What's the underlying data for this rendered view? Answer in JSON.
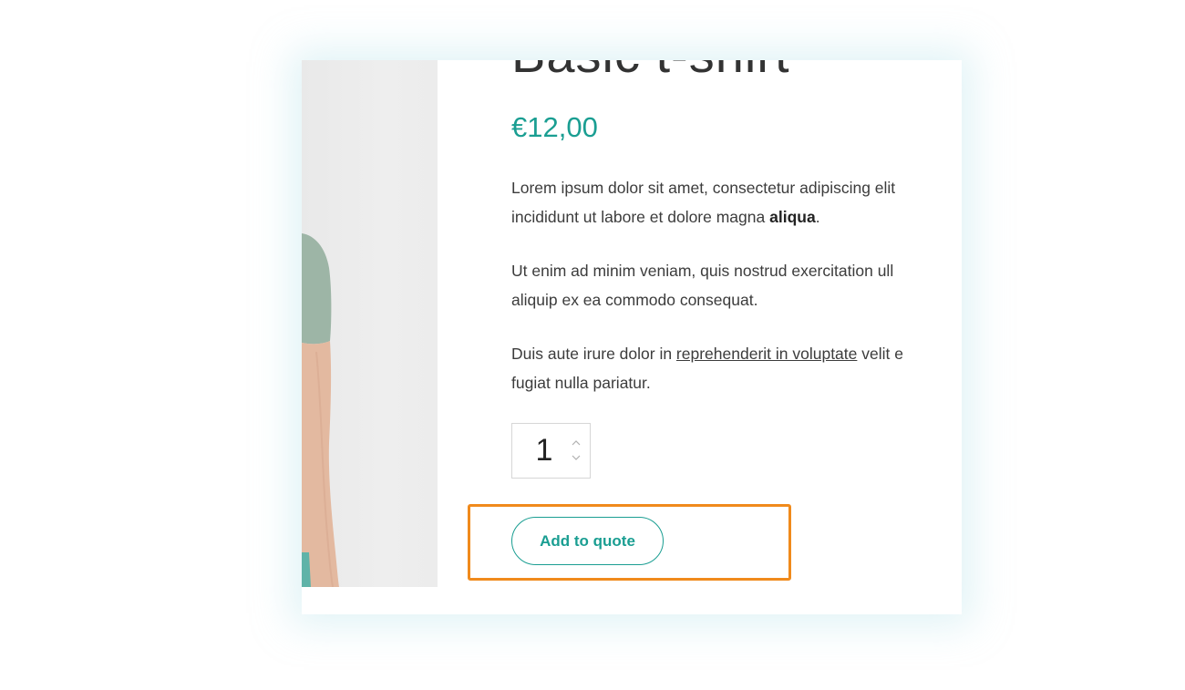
{
  "product": {
    "title": "Basic t-shirt",
    "price": "€12,00",
    "description": {
      "p1_line1": "Lorem ipsum dolor sit amet, consectetur adipiscing elit",
      "p1_line2_start": "incididunt ut labore et dolore magna ",
      "p1_bold": "aliqua",
      "p1_end": ".",
      "p2_line1": "Ut enim ad minim veniam, quis nostrud exercitation ull",
      "p2_line2": "aliquip ex ea commodo consequat.",
      "p3_start": "Duis aute irure dolor in ",
      "p3_link": "reprehenderit in voluptate",
      "p3_after_link": " velit e",
      "p3_line2": "fugiat nulla pariatur."
    },
    "quantity": "1",
    "quantity_up_icon": "chevron-up",
    "quantity_down_icon": "chevron-down"
  },
  "actions": {
    "add_to_quote_label": "Add to quote"
  },
  "colors": {
    "accent": "#1a9e92",
    "highlight": "#f08a1c",
    "text": "#3c3c3c"
  }
}
